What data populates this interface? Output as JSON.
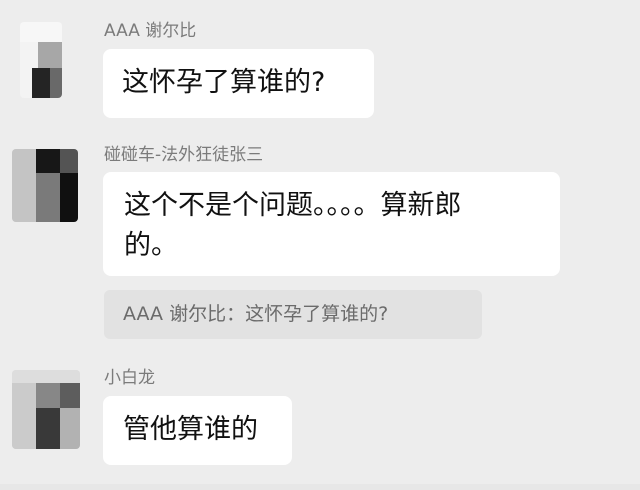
{
  "messages": [
    {
      "sender": "AAA 谢尔比",
      "text_lines": [
        "这怀孕了算谁的?"
      ]
    },
    {
      "sender": "碰碰车-法外狂徒张三",
      "text_lines": [
        "这个不是个问题。。。。算新郎",
        "的。"
      ],
      "quote": "AAA 谢尔比：这怀孕了算谁的?"
    },
    {
      "sender": "小白龙",
      "text_lines": [
        "管他算谁的"
      ]
    }
  ],
  "colors": {
    "background": "#ededed",
    "bubble": "#ffffff",
    "quote_background": "#e2e2e2",
    "sender_text": "#7b7b7b"
  },
  "icons": {
    "avatar": "blurred-profile-avatar-icon"
  }
}
